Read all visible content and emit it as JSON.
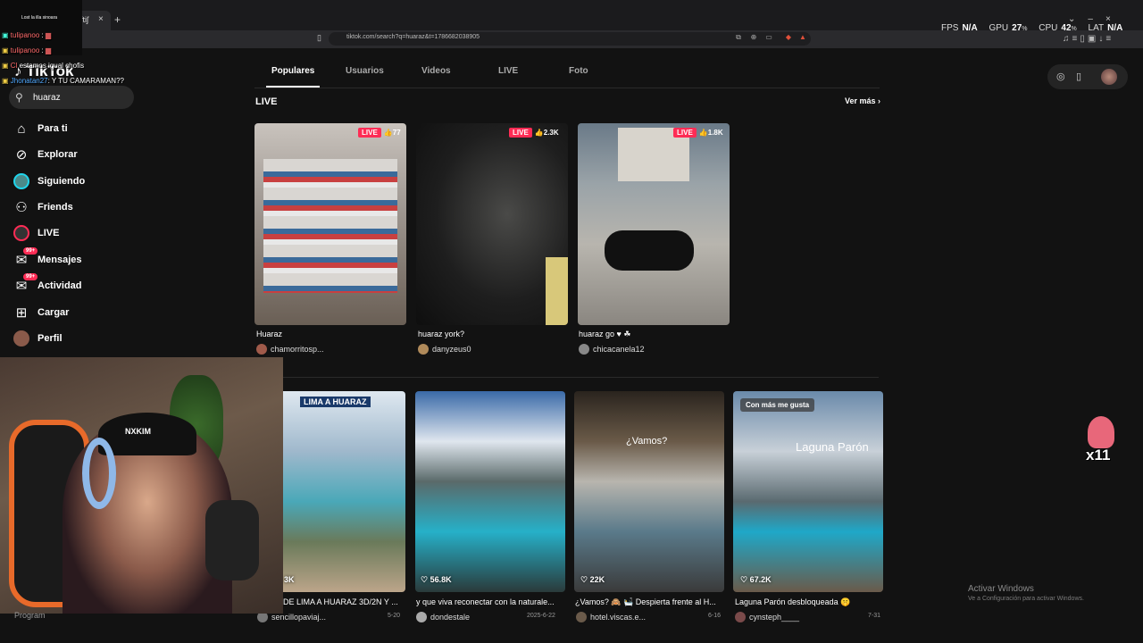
{
  "browser": {
    "tab_title": "ftiʃ",
    "tab_close": "×",
    "new_tab": "+",
    "url": "tiktok.com/search?q=huaraz&t=1786682038905"
  },
  "hud": {
    "fps_label": "FPS",
    "fps_value": "N/A",
    "gpu_label": "GPU",
    "gpu_value": "27",
    "cpu_label": "CPU",
    "cpu_value": "42",
    "lat_label": "LAT",
    "lat_value": "N/A"
  },
  "chat": {
    "title": "Lost la illa sinoara",
    "lines": [
      {
        "user": "tulipanoo",
        "msg": ":"
      },
      {
        "user": "tulipanoo",
        "msg": ":"
      },
      {
        "user": "Cl",
        "msg": "estamos igual chofis"
      },
      {
        "user": "Jhonatan27",
        "msg": ": Y TU CAMARAMAN??"
      }
    ]
  },
  "sidebar": {
    "logo": "TikTok",
    "search_value": "huaraz",
    "items": [
      {
        "label": "Para ti"
      },
      {
        "label": "Explorar"
      },
      {
        "label": "Siguiendo"
      },
      {
        "label": "Friends"
      },
      {
        "label": "LIVE"
      },
      {
        "label": "Mensajes",
        "badge": "99+"
      },
      {
        "label": "Actividad",
        "badge": "99+"
      },
      {
        "label": "Cargar"
      },
      {
        "label": "Perfil"
      }
    ],
    "bottom_label": "Program"
  },
  "webcam": {
    "cap_text": "NXKIM"
  },
  "tabs": [
    "Populares",
    "Usuarios",
    "Videos",
    "LIVE",
    "Foto"
  ],
  "live_section": {
    "heading": "LIVE",
    "see_more": "Ver más",
    "cards": [
      {
        "badge": "LIVE",
        "count": "77",
        "title": "Huaraz",
        "user": "chamorritosp..."
      },
      {
        "badge": "LIVE",
        "count": "2.3K",
        "title": "huaraz york?",
        "user": "danyzeus0"
      },
      {
        "badge": "LIVE",
        "count": "1.8K",
        "title": "huaraz go ♥ ☘",
        "user": "chicacanela12"
      }
    ]
  },
  "videos": [
    {
      "likes": "3K",
      "title": "DE LIMA A HUARAZ 3D/2N Y ...",
      "user": "sencillopaviaj...",
      "date": "5-20",
      "overlay": "LIMA A HUARAZ"
    },
    {
      "likes": "56.8K",
      "title": "y que viva reconectar con la naturale...",
      "user": "dondestale",
      "date": "2025-6-22"
    },
    {
      "likes": "22K",
      "title": "¿Vamos? 🙈 🛀 Despierta frente al H...",
      "user": "hotel.viscas.e...",
      "date": "6-16",
      "overlay": "¿Vamos?"
    },
    {
      "likes": "67.2K",
      "title": "Laguna Parón desbloqueada 🤫",
      "user": "cynsteph____",
      "date": "7-31",
      "badge": "Con más me gusta",
      "overlay": "Laguna Parón"
    }
  ],
  "sticker": {
    "count": "x11"
  },
  "activate": {
    "title": "Activar Windows",
    "subtitle": "Ve a Configuración para activar Windows."
  }
}
